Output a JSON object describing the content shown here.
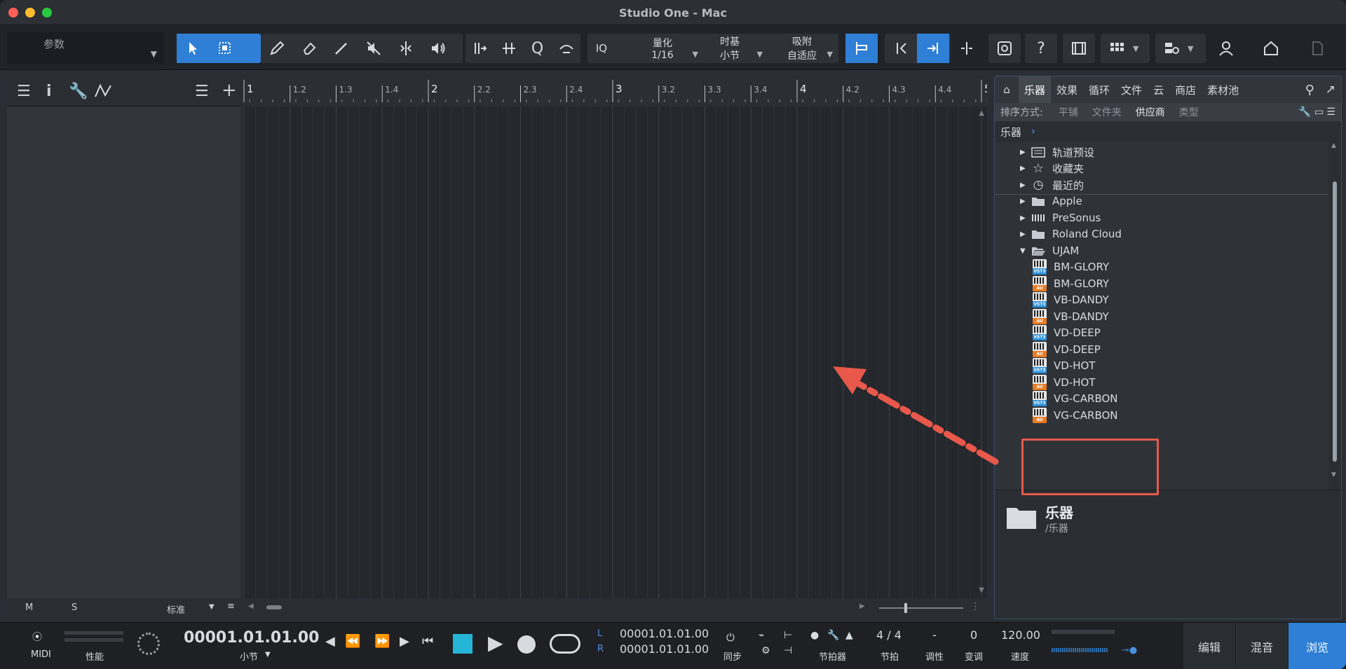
{
  "window": {
    "title": "Studio One - Mac"
  },
  "toolbar": {
    "param_label": "参数",
    "quantize": {
      "label": "量化",
      "value": "1/16"
    },
    "timebase": {
      "label": "时基",
      "value": "小节"
    },
    "snap": {
      "label": "吸附",
      "value": "自适应"
    },
    "iq_label": "IQ",
    "help_label": "?"
  },
  "inspector": {
    "info_label": "i",
    "m_label": "M",
    "s_label": "S",
    "mode_label": "标准"
  },
  "ruler": {
    "labels": [
      "1",
      "1.2",
      "1.3",
      "1.4",
      "2",
      "2.2",
      "2.3",
      "2.4",
      "3",
      "3.2",
      "3.3",
      "3.4",
      "4",
      "4.2",
      "4.3",
      "4.4",
      "5"
    ]
  },
  "browser": {
    "tabs": [
      "乐器",
      "效果",
      "循环",
      "文件",
      "云",
      "商店",
      "素材池"
    ],
    "sort_label": "排序方式:",
    "sort_options": [
      "平铺",
      "文件夹",
      "供应商",
      "类型"
    ],
    "path": "乐器",
    "top_items": [
      "轨道预设",
      "收藏夹",
      "最近的"
    ],
    "vendors": [
      "Apple",
      "PreSonus",
      "Roland Cloud",
      "UJAM"
    ],
    "plugins": [
      {
        "name": "BM-GLORY",
        "format": "VST3"
      },
      {
        "name": "BM-GLORY",
        "format": "AU"
      },
      {
        "name": "VB-DANDY",
        "format": "VST3"
      },
      {
        "name": "VB-DANDY",
        "format": "AU"
      },
      {
        "name": "VD-DEEP",
        "format": "VST3"
      },
      {
        "name": "VD-DEEP",
        "format": "AU"
      },
      {
        "name": "VD-HOT",
        "format": "VST3"
      },
      {
        "name": "VD-HOT",
        "format": "AU"
      },
      {
        "name": "VG-CARBON",
        "format": "VST3"
      },
      {
        "name": "VG-CARBON",
        "format": "AU"
      }
    ],
    "info_title": "乐器",
    "info_path": "/乐器"
  },
  "transport": {
    "midi_label": "MIDI",
    "perf_label": "性能",
    "time_display": "00001.01.01.00",
    "time_unit": "小节",
    "l_label": "L",
    "r_label": "R",
    "loop_start": "00001.01.01.00",
    "loop_end": "00001.01.01.00",
    "sync_label": "同步",
    "metronome_label": "节拍器",
    "signature": "4 / 4",
    "signature_label": "节拍",
    "key": "-",
    "key_label": "调性",
    "transpose": "0",
    "transpose_label": "变调",
    "tempo": "120.00",
    "tempo_label": "速度",
    "tabs": [
      "编辑",
      "混音",
      "浏览"
    ]
  },
  "colors": {
    "accent": "#2f7fd6",
    "highlight": "#e8584b"
  }
}
